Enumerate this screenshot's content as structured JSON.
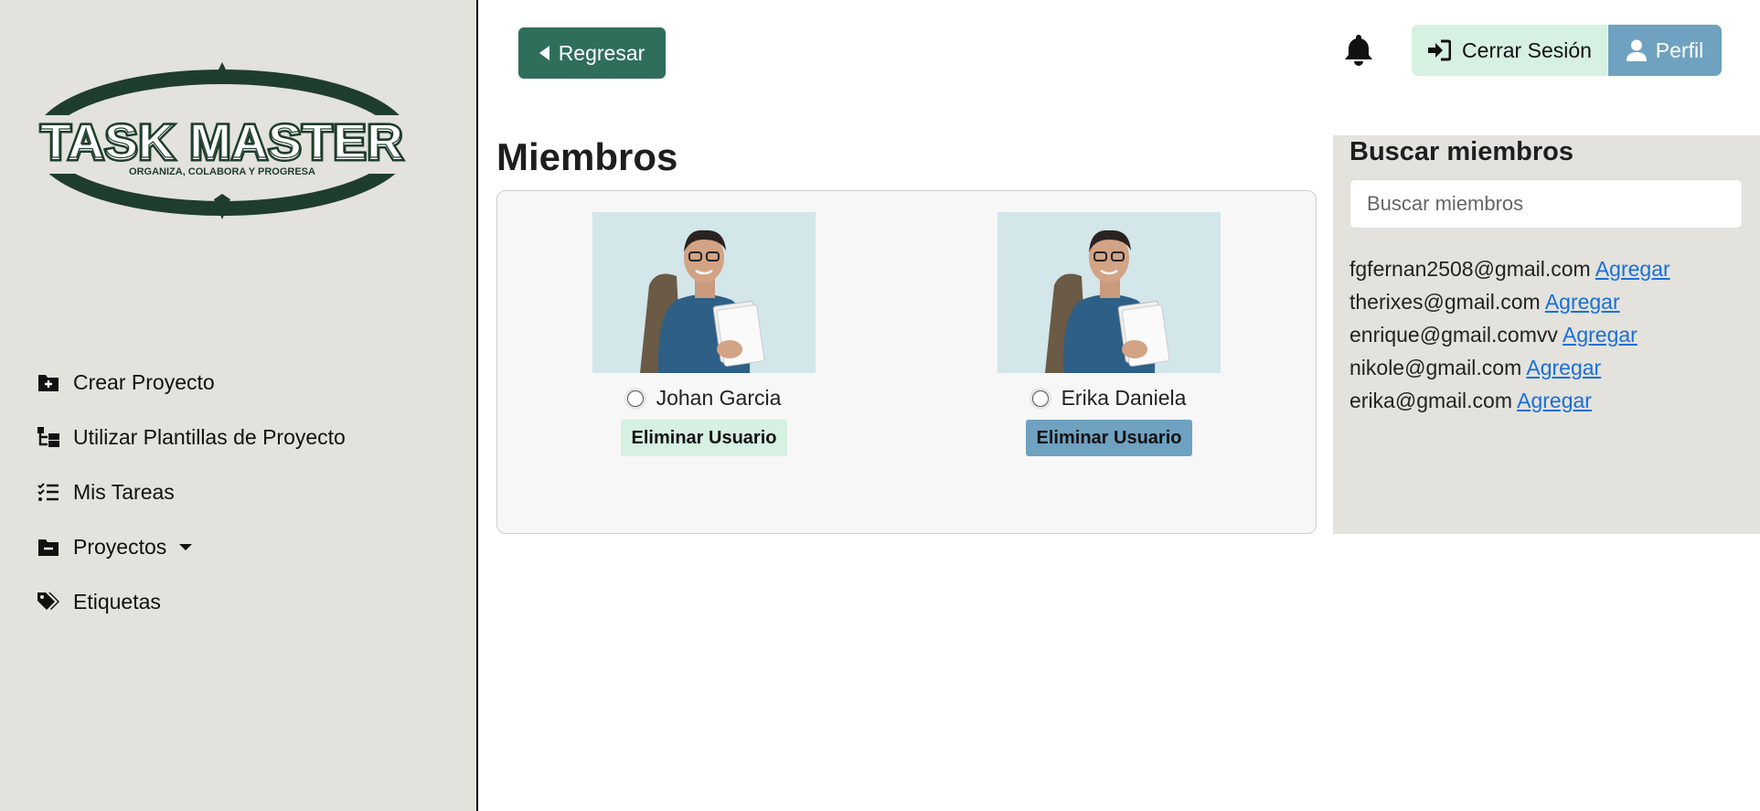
{
  "brand": {
    "logo_text": "TASK MASTER",
    "tagline": "ORGANIZA, COLABORA Y PROGRESA",
    "color": "#1f3d2c"
  },
  "sidebar": {
    "items": [
      {
        "label": "Crear Proyecto",
        "icon": "folder-plus-icon"
      },
      {
        "label": "Utilizar Plantillas de Proyecto",
        "icon": "template-tree-icon"
      },
      {
        "label": "Mis Tareas",
        "icon": "task-list-icon"
      },
      {
        "label": "Proyectos",
        "icon": "folder-minus-icon"
      },
      {
        "label": "Etiquetas",
        "icon": "tags-icon"
      }
    ]
  },
  "topbar": {
    "back_label": "Regresar",
    "logout_label": "Cerrar Sesión",
    "profile_label": "Perfil"
  },
  "members": {
    "title": "Miembros",
    "list": [
      {
        "name": "Johan Garcia",
        "action": "Eliminar Usuario"
      },
      {
        "name": "Erika Daniela",
        "action": "Eliminar Usuario"
      }
    ]
  },
  "search": {
    "title": "Buscar miembros",
    "placeholder": "Buscar miembros",
    "add_label": "Agregar",
    "results": [
      "fgfernan2508@gmail.com",
      "therixes@gmail.com",
      "enrique@gmail.comvv",
      "nikole@gmail.com",
      "erika@gmail.com"
    ]
  },
  "colors": {
    "sidebar_bg": "#e3e2dd",
    "primary_green": "#2f6e5b",
    "light_green": "#d6f0e2",
    "accent_blue": "#6fa2c0",
    "link_blue": "#1a6fd6"
  }
}
